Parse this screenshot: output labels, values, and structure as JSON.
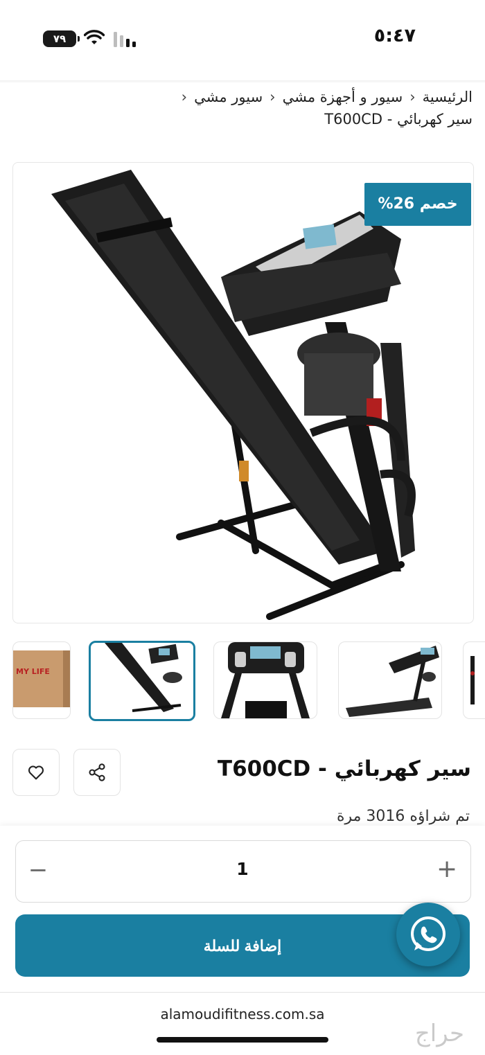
{
  "status_bar": {
    "time": "٥:٤٧",
    "battery": "٧٩"
  },
  "breadcrumb": {
    "items": [
      "الرئيسية",
      "سيور و أجهزة مشي",
      "سيور مشي"
    ],
    "current": "سير كهربائي - T600CD",
    "separator": "‹"
  },
  "product": {
    "badge": "خصم 26%",
    "title": "سير كهربائي - T600CD",
    "partial_line": "تم شراؤه 3016 مرة",
    "main_image_icon": "treadmill-image",
    "thumbnail_box_label": "MY LIFE",
    "thumbnails": [
      "box",
      "treadmill-folded",
      "console-front",
      "treadmill-side"
    ]
  },
  "quantity": {
    "minus": "−",
    "value": "1",
    "plus": "+"
  },
  "cart": {
    "add_label": "إضافة للسلة"
  },
  "browser": {
    "url": "alamoudifitness.com.sa",
    "watermark": "حراج"
  },
  "colors": {
    "accent": "#1a7fa1",
    "text": "#111111"
  }
}
